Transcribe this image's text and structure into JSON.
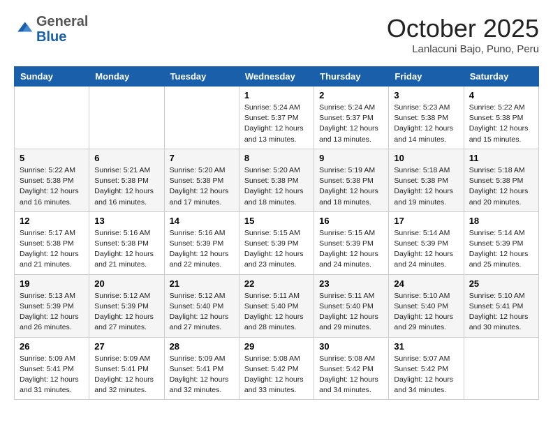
{
  "header": {
    "logo": {
      "general": "General",
      "blue": "Blue"
    },
    "title": "October 2025",
    "location": "Lanlacuni Bajo, Puno, Peru"
  },
  "weekdays": [
    "Sunday",
    "Monday",
    "Tuesday",
    "Wednesday",
    "Thursday",
    "Friday",
    "Saturday"
  ],
  "weeks": [
    [
      {
        "day": "",
        "info": ""
      },
      {
        "day": "",
        "info": ""
      },
      {
        "day": "",
        "info": ""
      },
      {
        "day": "1",
        "info": "Sunrise: 5:24 AM\nSunset: 5:37 PM\nDaylight: 12 hours\nand 13 minutes."
      },
      {
        "day": "2",
        "info": "Sunrise: 5:24 AM\nSunset: 5:37 PM\nDaylight: 12 hours\nand 13 minutes."
      },
      {
        "day": "3",
        "info": "Sunrise: 5:23 AM\nSunset: 5:38 PM\nDaylight: 12 hours\nand 14 minutes."
      },
      {
        "day": "4",
        "info": "Sunrise: 5:22 AM\nSunset: 5:38 PM\nDaylight: 12 hours\nand 15 minutes."
      }
    ],
    [
      {
        "day": "5",
        "info": "Sunrise: 5:22 AM\nSunset: 5:38 PM\nDaylight: 12 hours\nand 16 minutes."
      },
      {
        "day": "6",
        "info": "Sunrise: 5:21 AM\nSunset: 5:38 PM\nDaylight: 12 hours\nand 16 minutes."
      },
      {
        "day": "7",
        "info": "Sunrise: 5:20 AM\nSunset: 5:38 PM\nDaylight: 12 hours\nand 17 minutes."
      },
      {
        "day": "8",
        "info": "Sunrise: 5:20 AM\nSunset: 5:38 PM\nDaylight: 12 hours\nand 18 minutes."
      },
      {
        "day": "9",
        "info": "Sunrise: 5:19 AM\nSunset: 5:38 PM\nDaylight: 12 hours\nand 18 minutes."
      },
      {
        "day": "10",
        "info": "Sunrise: 5:18 AM\nSunset: 5:38 PM\nDaylight: 12 hours\nand 19 minutes."
      },
      {
        "day": "11",
        "info": "Sunrise: 5:18 AM\nSunset: 5:38 PM\nDaylight: 12 hours\nand 20 minutes."
      }
    ],
    [
      {
        "day": "12",
        "info": "Sunrise: 5:17 AM\nSunset: 5:38 PM\nDaylight: 12 hours\nand 21 minutes."
      },
      {
        "day": "13",
        "info": "Sunrise: 5:16 AM\nSunset: 5:38 PM\nDaylight: 12 hours\nand 21 minutes."
      },
      {
        "day": "14",
        "info": "Sunrise: 5:16 AM\nSunset: 5:39 PM\nDaylight: 12 hours\nand 22 minutes."
      },
      {
        "day": "15",
        "info": "Sunrise: 5:15 AM\nSunset: 5:39 PM\nDaylight: 12 hours\nand 23 minutes."
      },
      {
        "day": "16",
        "info": "Sunrise: 5:15 AM\nSunset: 5:39 PM\nDaylight: 12 hours\nand 24 minutes."
      },
      {
        "day": "17",
        "info": "Sunrise: 5:14 AM\nSunset: 5:39 PM\nDaylight: 12 hours\nand 24 minutes."
      },
      {
        "day": "18",
        "info": "Sunrise: 5:14 AM\nSunset: 5:39 PM\nDaylight: 12 hours\nand 25 minutes."
      }
    ],
    [
      {
        "day": "19",
        "info": "Sunrise: 5:13 AM\nSunset: 5:39 PM\nDaylight: 12 hours\nand 26 minutes."
      },
      {
        "day": "20",
        "info": "Sunrise: 5:12 AM\nSunset: 5:39 PM\nDaylight: 12 hours\nand 27 minutes."
      },
      {
        "day": "21",
        "info": "Sunrise: 5:12 AM\nSunset: 5:40 PM\nDaylight: 12 hours\nand 27 minutes."
      },
      {
        "day": "22",
        "info": "Sunrise: 5:11 AM\nSunset: 5:40 PM\nDaylight: 12 hours\nand 28 minutes."
      },
      {
        "day": "23",
        "info": "Sunrise: 5:11 AM\nSunset: 5:40 PM\nDaylight: 12 hours\nand 29 minutes."
      },
      {
        "day": "24",
        "info": "Sunrise: 5:10 AM\nSunset: 5:40 PM\nDaylight: 12 hours\nand 29 minutes."
      },
      {
        "day": "25",
        "info": "Sunrise: 5:10 AM\nSunset: 5:41 PM\nDaylight: 12 hours\nand 30 minutes."
      }
    ],
    [
      {
        "day": "26",
        "info": "Sunrise: 5:09 AM\nSunset: 5:41 PM\nDaylight: 12 hours\nand 31 minutes."
      },
      {
        "day": "27",
        "info": "Sunrise: 5:09 AM\nSunset: 5:41 PM\nDaylight: 12 hours\nand 32 minutes."
      },
      {
        "day": "28",
        "info": "Sunrise: 5:09 AM\nSunset: 5:41 PM\nDaylight: 12 hours\nand 32 minutes."
      },
      {
        "day": "29",
        "info": "Sunrise: 5:08 AM\nSunset: 5:42 PM\nDaylight: 12 hours\nand 33 minutes."
      },
      {
        "day": "30",
        "info": "Sunrise: 5:08 AM\nSunset: 5:42 PM\nDaylight: 12 hours\nand 34 minutes."
      },
      {
        "day": "31",
        "info": "Sunrise: 5:07 AM\nSunset: 5:42 PM\nDaylight: 12 hours\nand 34 minutes."
      },
      {
        "day": "",
        "info": ""
      }
    ]
  ]
}
